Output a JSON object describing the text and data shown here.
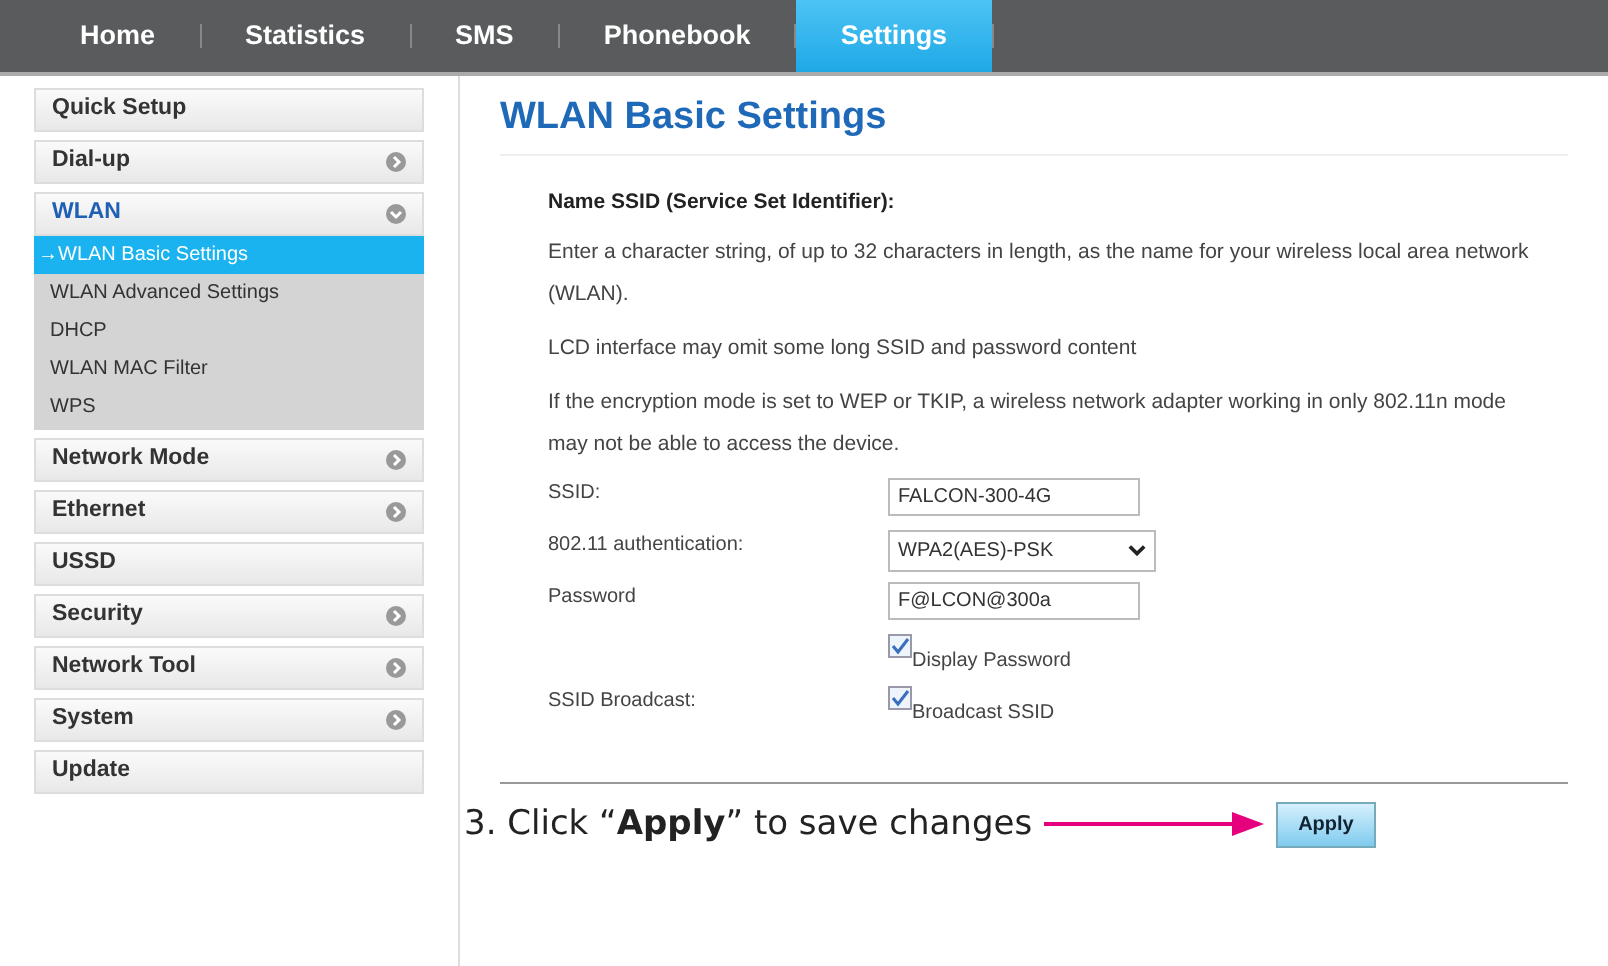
{
  "nav": [
    {
      "label": "Home",
      "selected": false
    },
    {
      "label": "Statistics",
      "selected": false
    },
    {
      "label": "SMS",
      "selected": false
    },
    {
      "label": "Phonebook",
      "selected": false
    },
    {
      "label": "Settings",
      "selected": true
    }
  ],
  "sidebar": {
    "items": [
      {
        "label": "Quick Setup"
      },
      {
        "label": "Dial-up",
        "expanded": false
      },
      {
        "label": "WLAN",
        "expanded": true,
        "children": [
          {
            "label": "→WLAN Basic Settings",
            "selected": true
          },
          {
            "label": "WLAN Advanced Settings",
            "selected": false
          },
          {
            "label": "DHCP",
            "selected": false
          },
          {
            "label": "WLAN MAC Filter",
            "selected": false
          },
          {
            "label": "WPS",
            "selected": false
          }
        ]
      },
      {
        "label": "Network Mode",
        "expanded": false
      },
      {
        "label": "Ethernet",
        "expanded": false
      },
      {
        "label": "USSD"
      },
      {
        "label": "Security",
        "expanded": false
      },
      {
        "label": "Network Tool",
        "expanded": false
      },
      {
        "label": "System",
        "expanded": false
      },
      {
        "label": "Update"
      }
    ]
  },
  "page_title": "WLAN Basic Settings",
  "section_heading": "Name SSID (Service Set Identifier):",
  "paragraphs": [
    "Enter a character string, of up to 32 characters in length, as the name for your wireless local area network (WLAN).",
    "LCD interface may omit some long SSID and password content",
    "If the encryption mode is set to WEP or TKIP, a wireless network adapter working in only 802.11n mode may not be able to access the device."
  ],
  "form": [
    {
      "kind": "text",
      "label": "SSID:",
      "value": "FALCON-300-4G"
    },
    {
      "kind": "select",
      "label": "802.11 authentication:",
      "value": "WPA2(AES)-PSK"
    },
    {
      "kind": "text",
      "label": "Password",
      "value": "F@LCON@300a"
    },
    {
      "kind": "checkbox",
      "option": "Display Password",
      "checked": true
    },
    {
      "kind": "checkbox",
      "label": "SSID Broadcast:",
      "option": "Broadcast SSID",
      "checked": true
    }
  ],
  "annotation": "3. Click “**Apply**” to save changes",
  "apply_button": "Apply"
}
